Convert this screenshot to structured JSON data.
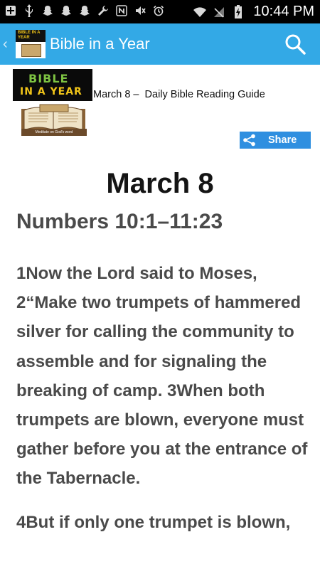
{
  "status_bar": {
    "time": "10:44 PM",
    "left_icons": [
      "add-icon",
      "usb-icon",
      "snapchat-icon",
      "snapchat-icon",
      "snapchat-icon",
      "wrench-icon",
      "nfc-icon",
      "mute-icon",
      "alarm-icon"
    ],
    "right_icons": [
      "wifi-icon",
      "no-sim-icon",
      "battery-charging-icon"
    ]
  },
  "app_bar": {
    "title": "Bible in a Year",
    "logo_text": "BIBLE IN A YEAR",
    "accent_color": "#33a9e6"
  },
  "header": {
    "logo_line1": "BIBLE",
    "logo_line2": "IN A YEAR",
    "guide_title": "March 8 –  Daily Bible Reading Guide",
    "image_caption": "Meditate on God's word",
    "share_label": "Share",
    "share_color": "#2f8fe0"
  },
  "reading": {
    "date": "March 8",
    "reference": "Numbers 10:1–11:23",
    "paragraph1": "1Now the Lord said to Moses, 2“Make two trumpets of hammered silver for calling the community to assemble and for signaling the breaking of camp. 3When both trumpets are blown, everyone must gather before you at the entrance of the Tabernacle.",
    "paragraph2": "4But if only one trumpet is blown,"
  }
}
